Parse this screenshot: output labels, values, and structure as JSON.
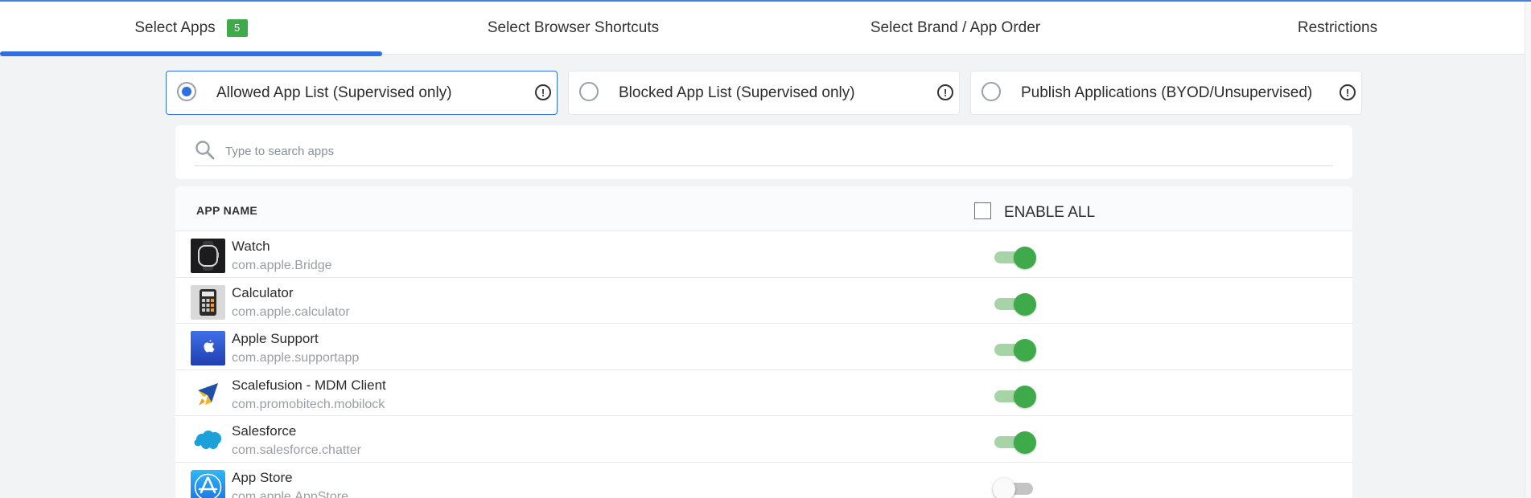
{
  "tabs": [
    {
      "label": "Select Apps",
      "badge": "5",
      "active": true
    },
    {
      "label": "Select Browser Shortcuts"
    },
    {
      "label": "Select Brand / App Order"
    },
    {
      "label": "Restrictions"
    }
  ],
  "modes": [
    {
      "label": "Allowed App List (Supervised only)",
      "selected": true
    },
    {
      "label": "Blocked App List (Supervised only)",
      "selected": false
    },
    {
      "label": "Publish Applications (BYOD/Unsupervised)",
      "selected": false
    }
  ],
  "search": {
    "placeholder": "Type to search apps",
    "value": ""
  },
  "table": {
    "col_app_name": "APP NAME",
    "enable_all_label": "ENABLE ALL",
    "enable_all_checked": false,
    "rows": [
      {
        "name": "Watch",
        "bundle_id": "com.apple.Bridge",
        "icon": "watch-icon",
        "enabled": true
      },
      {
        "name": "Calculator",
        "bundle_id": "com.apple.calculator",
        "icon": "calculator-icon",
        "enabled": true
      },
      {
        "name": "Apple Support",
        "bundle_id": "com.apple.supportapp",
        "icon": "apple-support-icon",
        "enabled": true
      },
      {
        "name": "Scalefusion - MDM Client",
        "bundle_id": "com.promobitech.mobilock",
        "icon": "scalefusion-icon",
        "enabled": true
      },
      {
        "name": "Salesforce",
        "bundle_id": "com.salesforce.chatter",
        "icon": "salesforce-icon",
        "enabled": true
      },
      {
        "name": "App Store",
        "bundle_id": "com.apple.AppStore",
        "icon": "app-store-icon",
        "enabled": false
      }
    ]
  },
  "colors": {
    "accent": "#2f6fe0",
    "toggle_on": "#3eaa4a",
    "badge": "#3eaa4a"
  }
}
